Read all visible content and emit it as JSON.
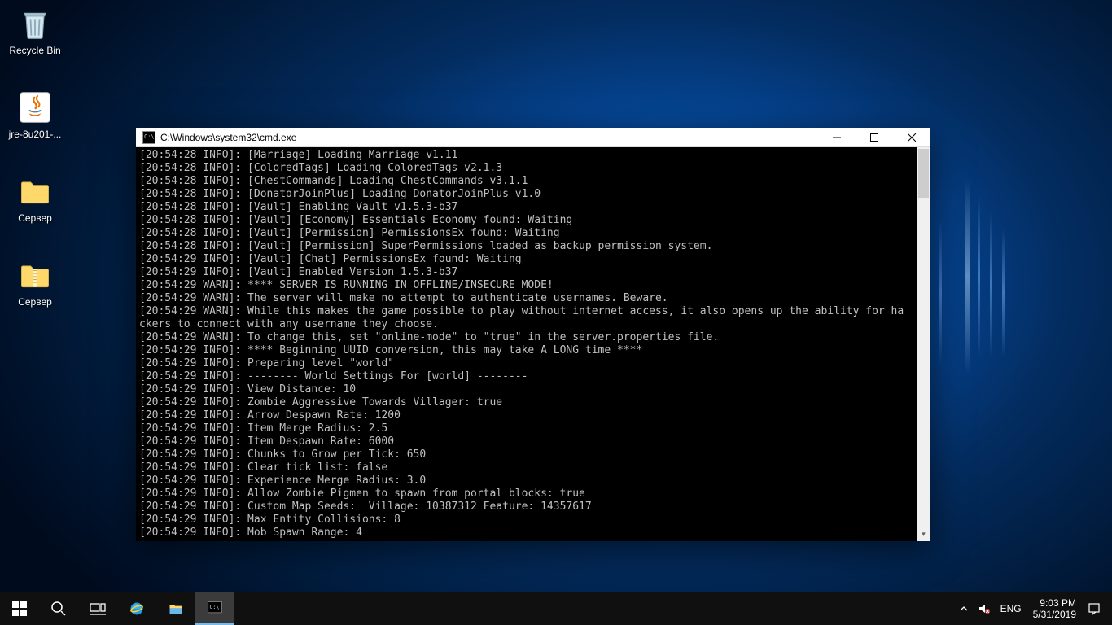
{
  "desktop": {
    "icons": [
      {
        "name": "recycle-bin",
        "label": "Recycle Bin"
      },
      {
        "name": "java-installer",
        "label": "jre-8u201-..."
      },
      {
        "name": "server-folder",
        "label": "Сервер"
      },
      {
        "name": "server-zip",
        "label": "Сервер"
      }
    ]
  },
  "window": {
    "title": "C:\\Windows\\system32\\cmd.exe",
    "lines": [
      {
        "tag": "[20:54:28 INFO]:",
        "text": " [Marriage] Loading Marriage v1.11"
      },
      {
        "tag": "[20:54:28 INFO]:",
        "text": " [ColoredTags] Loading ColoredTags v2.1.3"
      },
      {
        "tag": "[20:54:28 INFO]:",
        "text": " [ChestCommands] Loading ChestCommands v3.1.1"
      },
      {
        "tag": "[20:54:28 INFO]:",
        "text": " [DonatorJoinPlus] Loading DonatorJoinPlus v1.0"
      },
      {
        "tag": "[20:54:28 INFO]:",
        "text": " [Vault] Enabling Vault v1.5.3-b37"
      },
      {
        "tag": "[20:54:28 INFO]:",
        "text": " [Vault] [Economy] Essentials Economy found: Waiting"
      },
      {
        "tag": "[20:54:28 INFO]:",
        "text": " [Vault] [Permission] PermissionsEx found: Waiting"
      },
      {
        "tag": "[20:54:28 INFO]:",
        "text": " [Vault] [Permission] SuperPermissions loaded as backup permission system."
      },
      {
        "tag": "[20:54:29 INFO]:",
        "text": " [Vault] [Chat] PermissionsEx found: Waiting"
      },
      {
        "tag": "[20:54:29 INFO]:",
        "text": " [Vault] Enabled Version 1.5.3-b37"
      },
      {
        "tag": "[20:54:29 WARN]:",
        "text": " **** SERVER IS RUNNING IN OFFLINE/INSECURE MODE!"
      },
      {
        "tag": "[20:54:29 WARN]:",
        "text": " The server will make no attempt to authenticate usernames. Beware."
      },
      {
        "tag": "[20:54:29 WARN]:",
        "text": " While this makes the game possible to play without internet access, it also opens up the ability for ha"
      },
      {
        "tag": "",
        "text": "ckers to connect with any username they choose."
      },
      {
        "tag": "[20:54:29 WARN]:",
        "text": " To change this, set \"online-mode\" to \"true\" in the server.properties file."
      },
      {
        "tag": "[20:54:29 INFO]:",
        "text": " **** Beginning UUID conversion, this may take A LONG time ****"
      },
      {
        "tag": "[20:54:29 INFO]:",
        "text": " Preparing level \"world\""
      },
      {
        "tag": "[20:54:29 INFO]:",
        "text": " -------- World Settings For [world] --------"
      },
      {
        "tag": "[20:54:29 INFO]:",
        "text": " View Distance: 10"
      },
      {
        "tag": "[20:54:29 INFO]:",
        "text": " Zombie Aggressive Towards Villager: true"
      },
      {
        "tag": "[20:54:29 INFO]:",
        "text": " Arrow Despawn Rate: 1200"
      },
      {
        "tag": "[20:54:29 INFO]:",
        "text": " Item Merge Radius: 2.5"
      },
      {
        "tag": "[20:54:29 INFO]:",
        "text": " Item Despawn Rate: 6000"
      },
      {
        "tag": "[20:54:29 INFO]:",
        "text": " Chunks to Grow per Tick: 650"
      },
      {
        "tag": "[20:54:29 INFO]:",
        "text": " Clear tick list: false"
      },
      {
        "tag": "[20:54:29 INFO]:",
        "text": " Experience Merge Radius: 3.0"
      },
      {
        "tag": "[20:54:29 INFO]:",
        "text": " Allow Zombie Pigmen to spawn from portal blocks: true"
      },
      {
        "tag": "[20:54:29 INFO]:",
        "text": " Custom Map Seeds:  Village: 10387312 Feature: 14357617"
      },
      {
        "tag": "[20:54:29 INFO]:",
        "text": " Max Entity Collisions: 8"
      },
      {
        "tag": "[20:54:29 INFO]:",
        "text": " Mob Spawn Range: 4"
      }
    ]
  },
  "taskbar": {
    "lang": "ENG",
    "time": "9:03 PM",
    "date": "5/31/2019"
  }
}
